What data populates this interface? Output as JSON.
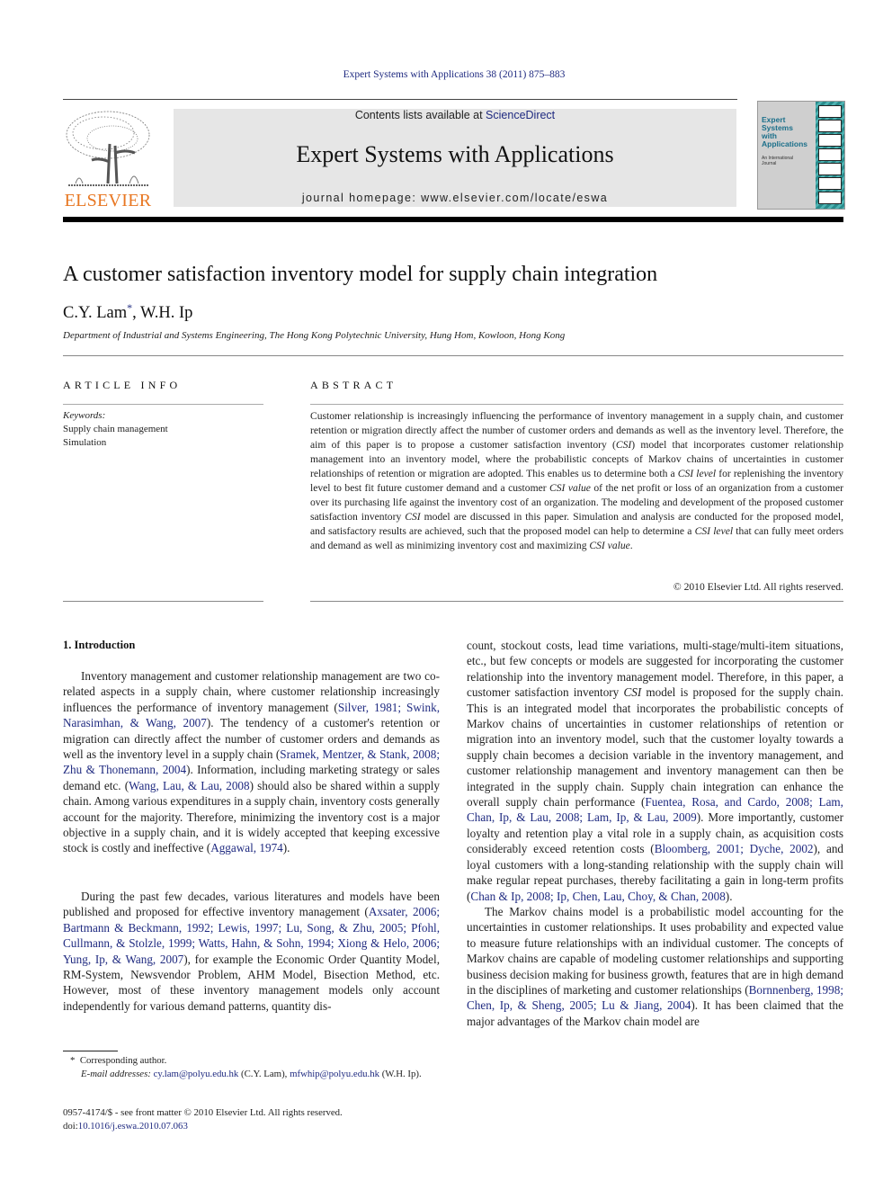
{
  "header": {
    "running_head": "Expert Systems with Applications 38 (2011) 875–883",
    "publisher": "ELSEVIER",
    "contents_prefix": "Contents lists available at ",
    "contents_link": "ScienceDirect",
    "journal_title": "Expert Systems with Applications",
    "homepage": "journal homepage: www.elsevier.com/locate/eswa",
    "cover": {
      "title_lines": [
        "Expert",
        "Systems",
        "with",
        "Applications"
      ],
      "subtitle_lines": [
        "An International",
        "Journal"
      ],
      "accent_color": "#2a8c8c"
    }
  },
  "article": {
    "title": "A customer satisfaction inventory model for supply chain integration",
    "authors": [
      {
        "name": "C.Y. Lam",
        "mark": "*"
      },
      {
        "name": "W.H. Ip",
        "mark": ""
      }
    ],
    "author_separator": ", ",
    "affiliation": "Department of Industrial and Systems Engineering, The Hong Kong Polytechnic University, Hung Hom, Kowloon, Hong Kong"
  },
  "article_info": {
    "heading": "ARTICLE INFO",
    "keywords_label": "Keywords:",
    "keywords": [
      "Supply chain management",
      "Simulation"
    ]
  },
  "abstract": {
    "heading": "ABSTRACT",
    "segments": [
      {
        "t": "Customer relationship is increasingly influencing the performance of inventory management in a supply chain, and customer retention or migration directly affect the number of customer orders and demands as well as the inventory level. Therefore, the aim of this paper is to propose a customer satisfaction inventory ("
      },
      {
        "t": "CSI",
        "i": true
      },
      {
        "t": ") model that incorporates customer relationship management into an inventory model, where the probabilistic concepts of Markov chains of uncertainties in customer relationships of retention or migration are adopted. This enables us to determine both a "
      },
      {
        "t": "CSI level",
        "i": true
      },
      {
        "t": " for replenishing the inventory level to best fit future customer demand and a customer "
      },
      {
        "t": "CSI value",
        "i": true
      },
      {
        "t": " of the net profit or loss of an organization from a customer over its purchasing life against the inventory cost of an organization. The modeling and development of the proposed customer satisfaction inventory "
      },
      {
        "t": "CSI",
        "i": true
      },
      {
        "t": " model are discussed in this paper. Simulation and analysis are conducted for the proposed model, and satisfactory results are achieved, such that the proposed model can help to determine a "
      },
      {
        "t": "CSI level",
        "i": true
      },
      {
        "t": " that can fully meet orders and demand as well as minimizing inventory cost and maximizing "
      },
      {
        "t": "CSI value",
        "i": true
      },
      {
        "t": "."
      }
    ],
    "copyright": "© 2010 Elsevier Ltd. All rights reserved."
  },
  "body": {
    "section_heading": "1. Introduction",
    "left_paragraphs": [
      [
        {
          "t": "Inventory management and customer relationship management are two co-related aspects in a supply chain, where customer relationship increasingly influences the performance of inventory management ("
        },
        {
          "t": "Silver, 1981; Swink, Narasimhan, & Wang, 2007",
          "l": true
        },
        {
          "t": "). The tendency of a customer's retention or migration can directly affect the number of customer orders and demands as well as the inventory level in a supply chain ("
        },
        {
          "t": "Sramek, Mentzer, & Stank, 2008; Zhu & Thonemann, 2004",
          "l": true
        },
        {
          "t": "). Information, including marketing strategy or sales demand etc. ("
        },
        {
          "t": "Wang, Lau, & Lau, 2008",
          "l": true
        },
        {
          "t": ") should also be shared within a supply chain. Among various expenditures in a supply chain, inventory costs generally account for the majority. Therefore, minimizing the inventory cost is a major objective in a supply chain, and it is widely accepted that keeping excessive stock is costly and ineffective ("
        },
        {
          "t": "Aggawal, 1974",
          "l": true
        },
        {
          "t": ")."
        }
      ],
      [
        {
          "t": "During the past few decades, various literatures and models have been published and proposed for effective inventory management ("
        },
        {
          "t": "Axsater, 2006; Bartmann & Beckmann, 1992; Lewis, 1997; Lu, Song, & Zhu, 2005; Pfohl, Cullmann, & Stolzle, 1999; Watts, Hahn, & Sohn, 1994; Xiong & Helo, 2006; Yung, Ip, & Wang, 2007",
          "l": true
        },
        {
          "t": "), for example the Economic Order Quantity Model, RM-System, Newsvendor Problem, AHM Model, Bisection Method, etc. However, most of these inventory management models only account independently for various demand patterns, quantity dis-"
        }
      ]
    ],
    "right_paragraphs": [
      [
        {
          "t": "count, stockout costs, lead time variations, multi-stage/multi-item situations, etc., but few concepts or models are suggested for incorporating the customer relationship into the inventory management model. Therefore, in this paper, a customer satisfaction inventory "
        },
        {
          "t": "CSI",
          "i": true
        },
        {
          "t": " model is proposed for the supply chain. This is an integrated model that incorporates the probabilistic concepts of Markov chains of uncertainties in customer relationships of retention or migration into an inventory model, such that the customer loyalty towards a supply chain becomes a decision variable in the inventory management, and customer relationship management and inventory management can then be integrated in the supply chain. Supply chain integration can enhance the overall supply chain performance ("
        },
        {
          "t": "Fuentea, Rosa, and Cardo, 2008; Lam, Chan, Ip, & Lau, 2008; Lam, Ip, & Lau, 2009",
          "l": true
        },
        {
          "t": "). More importantly, customer loyalty and retention play a vital role in a supply chain, as acquisition costs considerably exceed retention costs ("
        },
        {
          "t": "Bloomberg, 2001; Dyche, 2002",
          "l": true
        },
        {
          "t": "), and loyal customers with a long-standing relationship with the supply chain will make regular repeat purchases, thereby facilitating a gain in long-term profits ("
        },
        {
          "t": "Chan & Ip, 2008; Ip, Chen, Lau, Choy, & Chan, 2008",
          "l": true
        },
        {
          "t": ")."
        }
      ],
      [
        {
          "t": "The Markov chains model is a probabilistic model accounting for the uncertainties in customer relationships. It uses probability and expected value to measure future relationships with an individual customer. The concepts of Markov chains are capable of modeling customer relationships and supporting business decision making for business growth, features that are in high demand in the disciplines of marketing and customer relationships ("
        },
        {
          "t": "Bornnenberg, 1998; Chen, Ip, & Sheng, 2005; Lu & Jiang, 2004",
          "l": true
        },
        {
          "t": "). It has been claimed that the major advantages of the Markov chain model are"
        }
      ]
    ]
  },
  "footnote": {
    "mark": "*",
    "corresponding": "Corresponding author.",
    "email_label": "E-mail addresses:",
    "emails": [
      {
        "address": "cy.lam@polyu.edu.hk",
        "owner": "(C.Y. Lam)"
      },
      {
        "address": "mfwhip@polyu.edu.hk",
        "owner": "(W.H. Ip)."
      }
    ]
  },
  "front_matter": {
    "issn_line": "0957-4174/$ - see front matter © 2010 Elsevier Ltd. All rights reserved.",
    "doi_prefix": "doi:",
    "doi": "10.1016/j.eswa.2010.07.063"
  },
  "colors": {
    "link": "#1f2a80",
    "elsevier_orange": "#e87722",
    "masthead_bg": "#e6e6e6"
  }
}
